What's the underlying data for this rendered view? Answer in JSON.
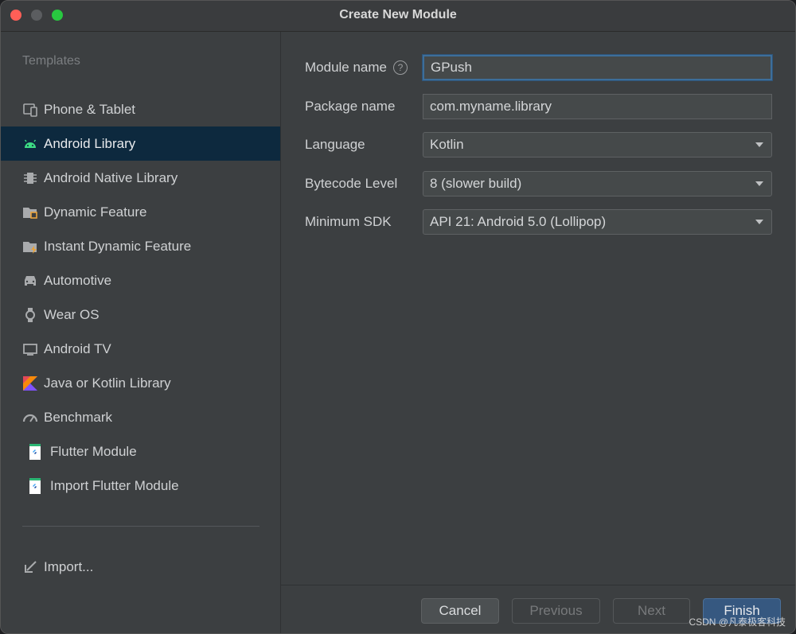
{
  "window": {
    "title": "Create New Module"
  },
  "sidebar": {
    "heading": "Templates",
    "items": [
      {
        "label": "Phone & Tablet",
        "icon": "phone-tablet-icon"
      },
      {
        "label": "Android Library",
        "icon": "android-icon",
        "selected": true
      },
      {
        "label": "Android Native Library",
        "icon": "native-library-icon"
      },
      {
        "label": "Dynamic Feature",
        "icon": "dynamic-feature-folder-icon"
      },
      {
        "label": "Instant Dynamic Feature",
        "icon": "instant-feature-folder-icon"
      },
      {
        "label": "Automotive",
        "icon": "car-icon"
      },
      {
        "label": "Wear OS",
        "icon": "watch-icon"
      },
      {
        "label": "Android TV",
        "icon": "tv-icon"
      },
      {
        "label": "Java or Kotlin Library",
        "icon": "kotlin-icon"
      },
      {
        "label": "Benchmark",
        "icon": "gauge-icon"
      },
      {
        "label": "Flutter Module",
        "icon": "flutter-icon"
      },
      {
        "label": "Import Flutter Module",
        "icon": "flutter-icon"
      }
    ],
    "import_label": "Import..."
  },
  "form": {
    "module_name": {
      "label": "Module name",
      "value": "GPush"
    },
    "package_name": {
      "label": "Package name",
      "value": "com.myname.library"
    },
    "language": {
      "label": "Language",
      "value": "Kotlin"
    },
    "bytecode_level": {
      "label": "Bytecode Level",
      "value": "8 (slower build)"
    },
    "minimum_sdk": {
      "label": "Minimum SDK",
      "value": "API 21: Android 5.0 (Lollipop)"
    }
  },
  "footer": {
    "cancel": "Cancel",
    "previous": "Previous",
    "next": "Next",
    "finish": "Finish"
  },
  "watermark": "CSDN @凡泰极客科技",
  "colors": {
    "selected_bg": "#0d293e",
    "android_green": "#3ddc84",
    "finish_blue": "#365880",
    "focus_border": "#3d6e9a"
  }
}
